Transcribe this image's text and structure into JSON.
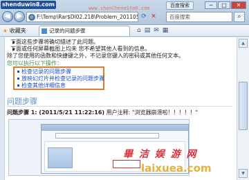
{
  "top_logo": "shenduwin8.com",
  "top_watermark": "www.shanCheneSteD.com",
  "address_bar": {
    "url": "F:\\Temp\\Rar$DI02.218\\Problem_2011052"
  },
  "search": {
    "placeholder": "百度搜索"
  },
  "top_button": "百度搜索",
  "window_controls": {
    "minimize": "─",
    "maximize": "□",
    "close": "✕"
  },
  "favorites": {
    "label": "收藏夹"
  },
  "tab": {
    "title": "记录的问题步骤"
  },
  "content": {
    "line1": "下面这些步骤将确切描述了此问题。",
    "line2": "下面或任何屏幕截图上均未 您不希望其他人看到的信息。",
    "line3": "除了您使用的函数和快捷键之外，不记录您键入的密码或其他任何文本。",
    "links_heading": "您可以执行以下操作：",
    "links": [
      "检查记录的问题步骤",
      "放映幻灯片并检查记录的问题步骤",
      "检查其他详细信息"
    ],
    "section_title": "问题步骤",
    "step_label": "问题步骤 1: (2011/5/21 11:22:16)",
    "step_text": " 用户注释: \"浏览器崩溃啦！！！！！\""
  },
  "watermark": {
    "cn": "畢 洁 娱 游 网",
    "en": "laixuea.com"
  }
}
